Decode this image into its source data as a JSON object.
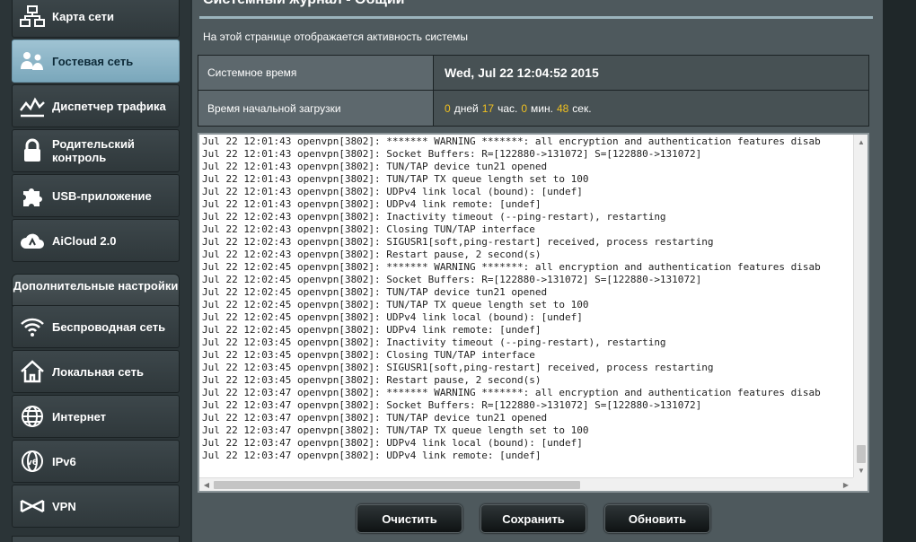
{
  "sidebar": {
    "items": [
      {
        "label": "Карта сети",
        "icon": "network-map-icon"
      },
      {
        "label": "Гостевая сеть",
        "icon": "guest-network-icon",
        "active": true
      },
      {
        "label": "Диспетчер трафика",
        "icon": "traffic-manager-icon"
      },
      {
        "label": "Родительский контроль",
        "icon": "parental-control-lock-icon"
      },
      {
        "label": "USB-приложение",
        "icon": "usb-puzzle-icon"
      },
      {
        "label": "AiCloud 2.0",
        "icon": "aicloud-icon"
      }
    ],
    "advanced_header": "Дополнительные настройки",
    "advanced_items": [
      {
        "label": "Беспроводная сеть",
        "icon": "wireless-icon"
      },
      {
        "label": "Локальная сеть",
        "icon": "home-lan-icon"
      },
      {
        "label": "Интернет",
        "icon": "globe-icon"
      },
      {
        "label": "IPv6",
        "icon": "ipv6-icon"
      },
      {
        "label": "VPN",
        "icon": "vpn-icon"
      }
    ]
  },
  "main": {
    "title": "Системный журнал - Общий",
    "description": "На этой странице отображается активность системы",
    "system_time_label": "Системное время",
    "system_time_value": "Wed, Jul 22 12:04:52 2015",
    "uptime_label": "Время начальной загрузки",
    "uptime": {
      "days": "0",
      "days_unit": "дней",
      "hours": "17",
      "hours_unit": "час.",
      "minutes": "0",
      "minutes_unit": "мин.",
      "seconds": "48",
      "seconds_unit": "сек."
    },
    "accent_color": "#f0c020"
  },
  "log_lines": [
    "Jul 22 12:01:43 openvpn[3802]: ******* WARNING *******: all encryption and authentication features disab",
    "Jul 22 12:01:43 openvpn[3802]: Socket Buffers: R=[122880->131072] S=[122880->131072]",
    "Jul 22 12:01:43 openvpn[3802]: TUN/TAP device tun21 opened",
    "Jul 22 12:01:43 openvpn[3802]: TUN/TAP TX queue length set to 100",
    "Jul 22 12:01:43 openvpn[3802]: UDPv4 link local (bound): [undef]",
    "Jul 22 12:01:43 openvpn[3802]: UDPv4 link remote: [undef]",
    "Jul 22 12:02:43 openvpn[3802]: Inactivity timeout (--ping-restart), restarting",
    "Jul 22 12:02:43 openvpn[3802]: Closing TUN/TAP interface",
    "Jul 22 12:02:43 openvpn[3802]: SIGUSR1[soft,ping-restart] received, process restarting",
    "Jul 22 12:02:43 openvpn[3802]: Restart pause, 2 second(s)",
    "Jul 22 12:02:45 openvpn[3802]: ******* WARNING *******: all encryption and authentication features disab",
    "Jul 22 12:02:45 openvpn[3802]: Socket Buffers: R=[122880->131072] S=[122880->131072]",
    "Jul 22 12:02:45 openvpn[3802]: TUN/TAP device tun21 opened",
    "Jul 22 12:02:45 openvpn[3802]: TUN/TAP TX queue length set to 100",
    "Jul 22 12:02:45 openvpn[3802]: UDPv4 link local (bound): [undef]",
    "Jul 22 12:02:45 openvpn[3802]: UDPv4 link remote: [undef]",
    "Jul 22 12:03:45 openvpn[3802]: Inactivity timeout (--ping-restart), restarting",
    "Jul 22 12:03:45 openvpn[3802]: Closing TUN/TAP interface",
    "Jul 22 12:03:45 openvpn[3802]: SIGUSR1[soft,ping-restart] received, process restarting",
    "Jul 22 12:03:45 openvpn[3802]: Restart pause, 2 second(s)",
    "Jul 22 12:03:47 openvpn[3802]: ******* WARNING *******: all encryption and authentication features disab",
    "Jul 22 12:03:47 openvpn[3802]: Socket Buffers: R=[122880->131072] S=[122880->131072]",
    "Jul 22 12:03:47 openvpn[3802]: TUN/TAP device tun21 opened",
    "Jul 22 12:03:47 openvpn[3802]: TUN/TAP TX queue length set to 100",
    "Jul 22 12:03:47 openvpn[3802]: UDPv4 link local (bound): [undef]",
    "Jul 22 12:03:47 openvpn[3802]: UDPv4 link remote: [undef]"
  ],
  "buttons": {
    "clear": "Очистить",
    "save": "Сохранить",
    "refresh": "Обновить"
  }
}
